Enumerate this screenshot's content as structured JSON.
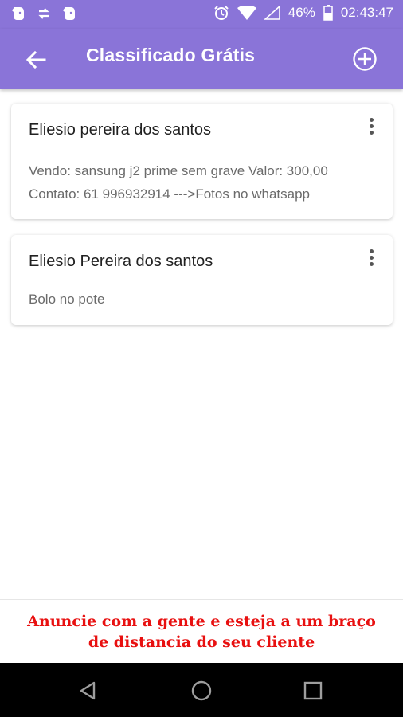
{
  "status_bar": {
    "battery": "46%",
    "time": "02:43:47",
    "left_icons": [
      "evernote-icon",
      "sync-icon",
      "evernote-icon"
    ],
    "right_icons": [
      "alarm-icon",
      "wifi-icon",
      "signal-icon",
      "battery-icon"
    ]
  },
  "app_bar": {
    "title": "Classificado Grátis",
    "back_icon": "arrow-back-icon",
    "add_icon": "add-circle-icon"
  },
  "listings": [
    {
      "author": "Eliesio pereira dos santos",
      "lines": [
        "Vendo: sansung j2 prime sem grave Valor: 300,00",
        "Contato: 61 996932914 --->Fotos no whatsapp"
      ]
    },
    {
      "author": "Eliesio Pereira dos santos",
      "lines": [
        "Bolo no pote"
      ]
    }
  ],
  "banner": {
    "line1": "Anuncie com a gente e esteja a um braço",
    "line2": "de distancia do seu cliente",
    "color": "#e81010"
  },
  "theme": {
    "primary": "#8a74d8"
  },
  "nav_bar": {
    "icons": [
      "back-triangle-icon",
      "home-circle-icon",
      "recents-square-icon"
    ]
  }
}
